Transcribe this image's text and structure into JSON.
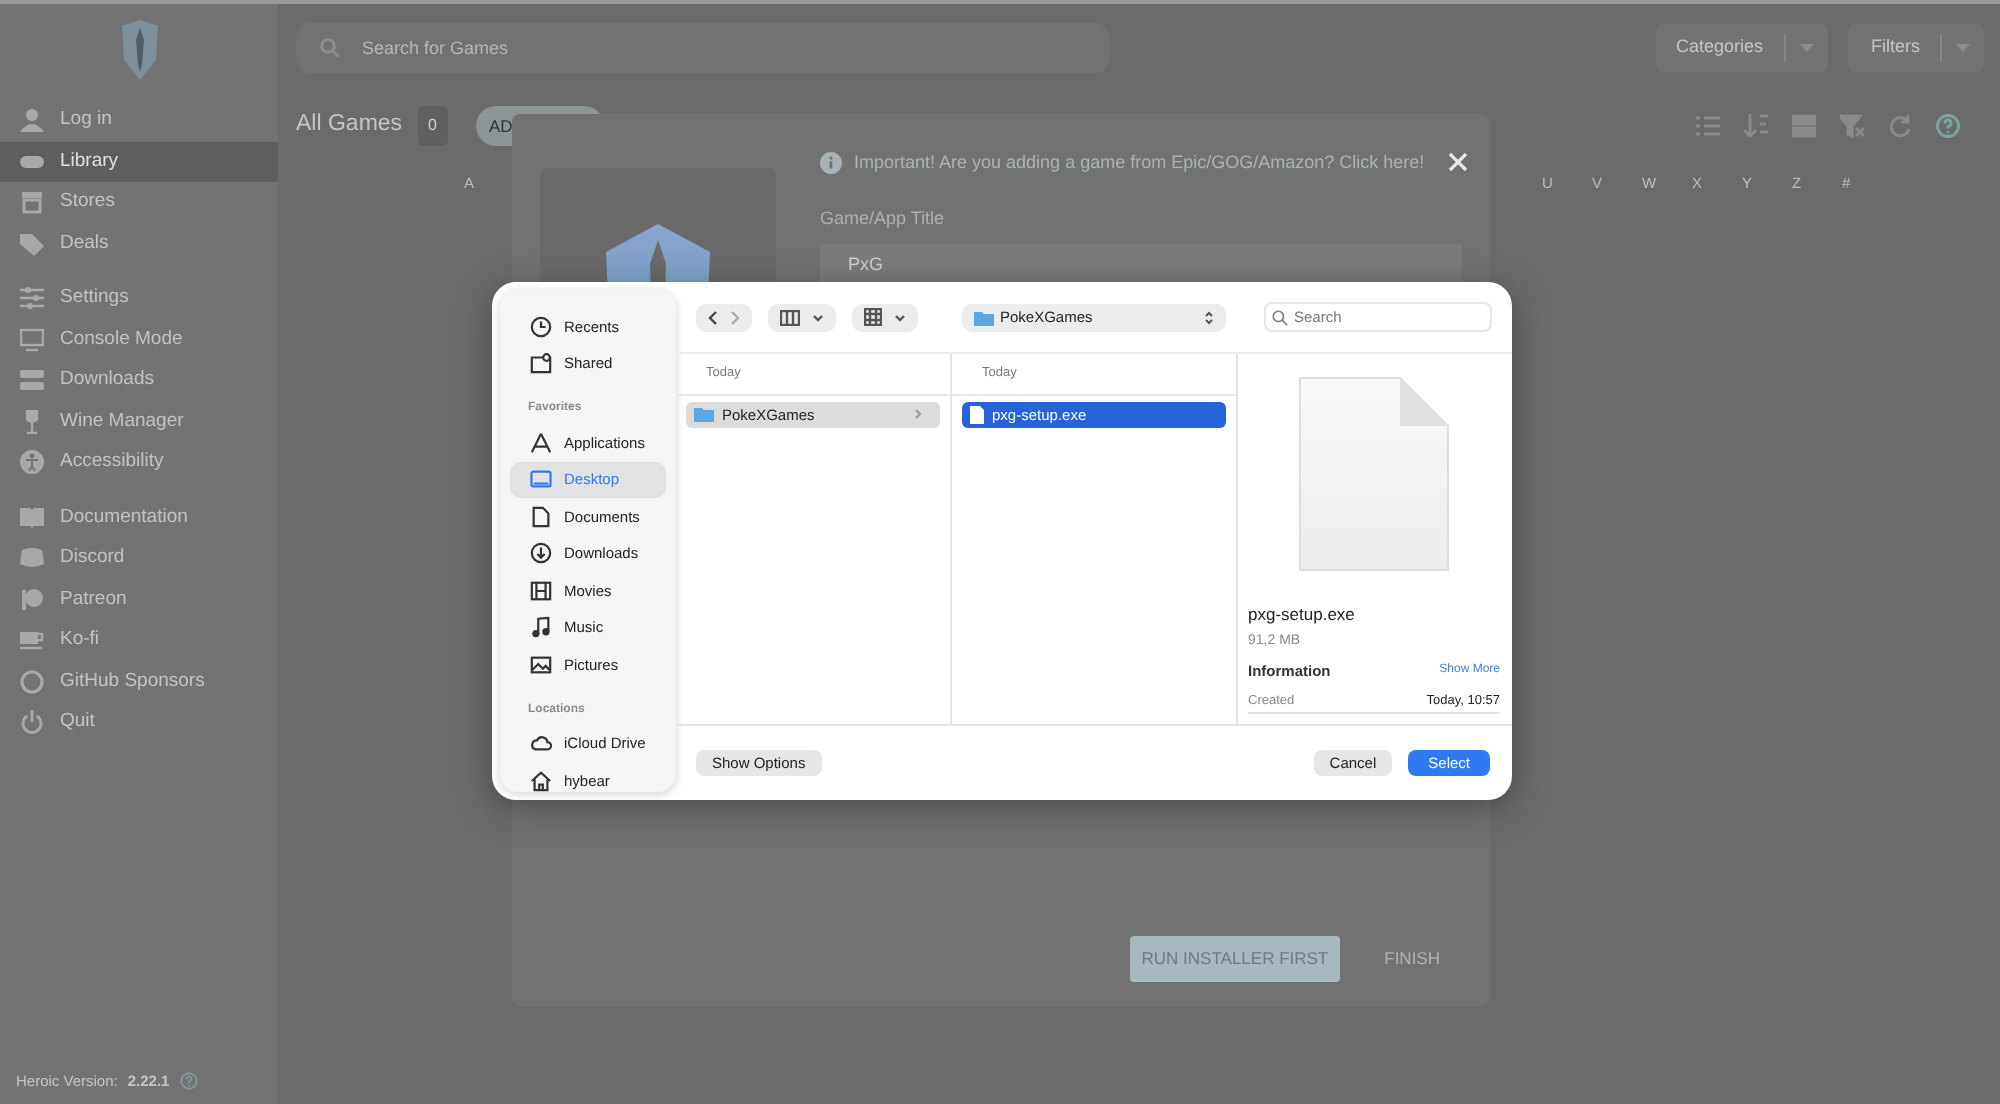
{
  "sidebar": {
    "groups": [
      [
        {
          "label": "Log in",
          "selected": false
        },
        {
          "label": "Library",
          "selected": true
        },
        {
          "label": "Stores",
          "selected": false
        },
        {
          "label": "Deals",
          "selected": false
        }
      ],
      [
        {
          "label": "Settings",
          "selected": false
        },
        {
          "label": "Console Mode",
          "selected": false
        },
        {
          "label": "Downloads",
          "selected": false
        },
        {
          "label": "Wine Manager",
          "selected": false
        },
        {
          "label": "Accessibility",
          "selected": false
        }
      ],
      [
        {
          "label": "Documentation",
          "selected": false
        },
        {
          "label": "Discord",
          "selected": false
        },
        {
          "label": "Patreon",
          "selected": false
        },
        {
          "label": "Ko-fi",
          "selected": false
        },
        {
          "label": "GitHub Sponsors",
          "selected": false
        },
        {
          "label": "Quit",
          "selected": false
        }
      ]
    ],
    "version_label": "Heroic Version:",
    "version": "2.22.1"
  },
  "topbar": {
    "search": {
      "placeholder": "Search for Games"
    },
    "buttons": [
      "Categories",
      "Filters"
    ]
  },
  "library": {
    "title": "All Games",
    "count": "0",
    "add_button": "AD",
    "letters": [
      "A",
      "U",
      "V",
      "W",
      "X",
      "Y",
      "Z",
      "#"
    ]
  },
  "modal": {
    "notice": "Important! Are you adding a game from Epic/GOG/Amazon? Click here!",
    "title_label": "Game/App Title",
    "title_value": "PxG",
    "buttons": [
      "RUN INSTALLER FIRST",
      "FINISH"
    ]
  },
  "file_dialog": {
    "sidebar": [
      {
        "items": [
          {
            "label": "Recents",
            "selected": false
          },
          {
            "label": "Shared",
            "selected": false
          }
        ]
      },
      {
        "heading": "Favorites",
        "items": [
          {
            "label": "Applications",
            "selected": false
          },
          {
            "label": "Desktop",
            "selected": true
          },
          {
            "label": "Documents",
            "selected": false
          },
          {
            "label": "Downloads",
            "selected": false
          },
          {
            "label": "Movies",
            "selected": false
          },
          {
            "label": "Music",
            "selected": false
          },
          {
            "label": "Pictures",
            "selected": false
          }
        ]
      },
      {
        "heading": "Locations",
        "items": [
          {
            "label": "iCloud Drive",
            "selected": false
          },
          {
            "label": "hybear",
            "selected": false
          }
        ]
      }
    ],
    "location": "PokeXGames",
    "search": {
      "placeholder": "Search"
    },
    "columns": [
      {
        "header": "Today",
        "active": false,
        "items": [
          {
            "name": "PokeXGames",
            "kind": "folder",
            "selected": true
          }
        ]
      },
      {
        "header": "Today",
        "active": true,
        "items": [
          {
            "name": "pxg-setup.exe",
            "kind": "file",
            "selected": true
          }
        ]
      }
    ],
    "preview": {
      "name": "pxg-setup.exe",
      "size": "91,2 MB",
      "info_heading": "Information",
      "more_link": "Show More",
      "rows": [
        {
          "label": "Created",
          "value": "Today, 10:57"
        }
      ]
    },
    "options_button": "Show Options",
    "buttons": [
      {
        "label": "Cancel",
        "kind": "secondary"
      },
      {
        "label": "Select",
        "kind": "primary"
      }
    ]
  }
}
